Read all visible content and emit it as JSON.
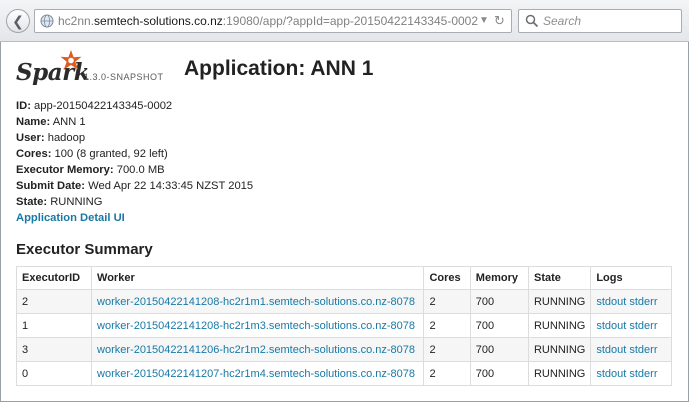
{
  "browser": {
    "url_scheme_host_prefix": "hc2nn.",
    "url_host": "semtech-solutions.co.nz",
    "url_rest": ":19080/app/?appId=app-20150422143345-0002",
    "search_placeholder": "Search",
    "icons": {
      "back": "back-arrow-icon",
      "site": "globe-icon",
      "dropdown": "dropdown-icon",
      "reload": "reload-icon",
      "search": "search-icon"
    }
  },
  "header": {
    "logo_text": "Spark",
    "version": "1.3.0-SNAPSHOT",
    "title": "Application: ANN 1",
    "logo_star_color": "#e25a1c"
  },
  "info": [
    {
      "key": "ID:",
      "value": "app-20150422143345-0002"
    },
    {
      "key": "Name:",
      "value": "ANN 1"
    },
    {
      "key": "User:",
      "value": "hadoop"
    },
    {
      "key": "Cores:",
      "value": "100 (8 granted, 92 left)"
    },
    {
      "key": "Executor Memory:",
      "value": "700.0 MB"
    },
    {
      "key": "Submit Date:",
      "value": "Wed Apr 22 14:33:45 NZST 2015"
    },
    {
      "key": "State:",
      "value": "RUNNING"
    }
  ],
  "detail_link": "Application Detail UI",
  "executor_summary": {
    "title": "Executor Summary",
    "columns": [
      "ExecutorID",
      "Worker",
      "Cores",
      "Memory",
      "State",
      "Logs"
    ],
    "rows": [
      {
        "id": "2",
        "worker": "worker-20150422141208-hc2r1m1.semtech-solutions.co.nz-8078",
        "cores": "2",
        "memory": "700",
        "state": "RUNNING",
        "stdout": "stdout",
        "stderr": "stderr"
      },
      {
        "id": "1",
        "worker": "worker-20150422141208-hc2r1m3.semtech-solutions.co.nz-8078",
        "cores": "2",
        "memory": "700",
        "state": "RUNNING",
        "stdout": "stdout",
        "stderr": "stderr"
      },
      {
        "id": "3",
        "worker": "worker-20150422141206-hc2r1m2.semtech-solutions.co.nz-8078",
        "cores": "2",
        "memory": "700",
        "state": "RUNNING",
        "stdout": "stdout",
        "stderr": "stderr"
      },
      {
        "id": "0",
        "worker": "worker-20150422141207-hc2r1m4.semtech-solutions.co.nz-8078",
        "cores": "2",
        "memory": "700",
        "state": "RUNNING",
        "stdout": "stdout",
        "stderr": "stderr"
      }
    ]
  },
  "colors": {
    "link": "#1779a6",
    "row_stripe": "#f6f6f6"
  }
}
